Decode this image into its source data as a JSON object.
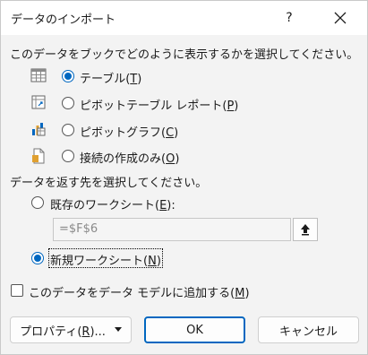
{
  "window": {
    "title": "データのインポート",
    "help_label": "?"
  },
  "prompt_view": "このデータをブックでどのように表示するかを選択してください。",
  "view_options": [
    {
      "label_pre": "テーブル(",
      "key": "T",
      "label_post": ")",
      "icon": "table-icon",
      "selected": true
    },
    {
      "label_pre": "ピボットテーブル レポート(",
      "key": "P",
      "label_post": ")",
      "icon": "pivottable-icon",
      "selected": false
    },
    {
      "label_pre": "ピボットグラフ(",
      "key": "C",
      "label_post": ")",
      "icon": "pivotchart-icon",
      "selected": false
    },
    {
      "label_pre": "接続の作成のみ(",
      "key": "O",
      "label_post": ")",
      "icon": "connection-only-icon",
      "selected": false
    }
  ],
  "prompt_destination": "データを返す先を選択してください。",
  "destination_options": [
    {
      "label_pre": "既存のワークシート(",
      "key": "E",
      "label_post": "):",
      "selected": false
    },
    {
      "label_pre": "新規ワークシート(",
      "key": "N",
      "label_post": ")",
      "selected": true
    }
  ],
  "cell_reference": {
    "value": "=$F$6",
    "button_icon": "collapse-dialog-icon"
  },
  "data_model": {
    "label_pre": "このデータをデータ モデルに追加する(",
    "key": "M",
    "label_post": ")",
    "checked": false
  },
  "buttons": {
    "properties_pre": "プロパティ(",
    "properties_key": "R",
    "properties_post": ")...",
    "ok": "OK",
    "cancel": "キャンセル"
  },
  "colors": {
    "accent": "#0067c0",
    "background": "#f3f3f3"
  }
}
